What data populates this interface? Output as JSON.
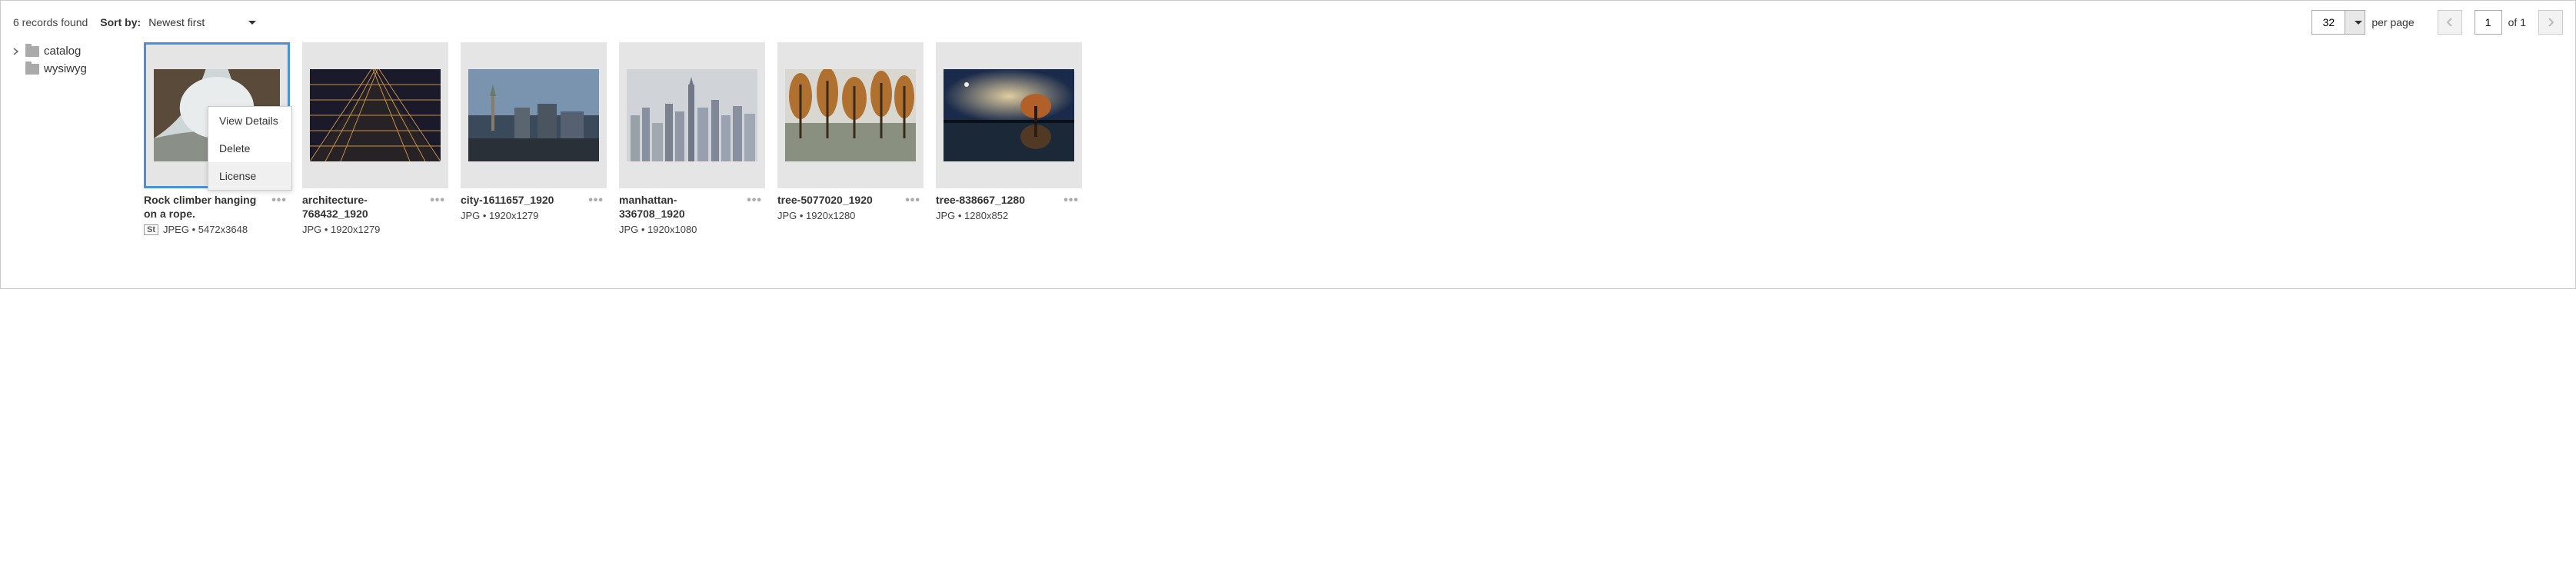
{
  "toolbar": {
    "records_found": "6 records found",
    "sort_label": "Sort by:",
    "sort_value": "Newest first",
    "per_page_value": "32",
    "per_page_label": "per page",
    "page_value": "1",
    "of_label": "of 1"
  },
  "sidebar": {
    "items": [
      {
        "label": "catalog",
        "expandable": true
      },
      {
        "label": "wysiwyg",
        "expandable": false
      }
    ]
  },
  "context_menu": {
    "items": [
      {
        "label": "View Details"
      },
      {
        "label": "Delete"
      },
      {
        "label": "License"
      }
    ]
  },
  "gallery": [
    {
      "title": "Rock climber hanging on a rope.",
      "meta": "JPEG • 5472x3648",
      "badge": "St",
      "selected": true,
      "menu": true
    },
    {
      "title": "architecture-768432_1920",
      "meta": "JPG • 1920x1279"
    },
    {
      "title": "city-1611657_1920",
      "meta": "JPG • 1920x1279"
    },
    {
      "title": "manhattan-336708_1920",
      "meta": "JPG • 1920x1080"
    },
    {
      "title": "tree-5077020_1920",
      "meta": "JPG • 1920x1280"
    },
    {
      "title": "tree-838667_1280",
      "meta": "JPG • 1280x852"
    }
  ]
}
